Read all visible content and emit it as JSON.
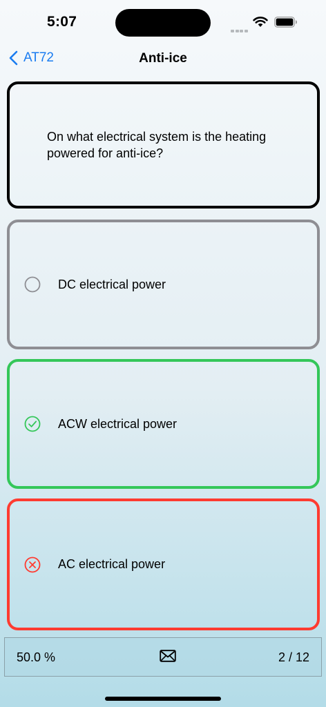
{
  "status_bar": {
    "time": "5:07",
    "icons": [
      "signal-dots-icon",
      "wifi-icon",
      "battery-icon"
    ]
  },
  "nav": {
    "back_label": "AT72",
    "title": "Anti-ice",
    "accent_color": "#1a7cf0"
  },
  "question": {
    "text": "On what electrical system is the heating powered for anti-ice?"
  },
  "answers": [
    {
      "label": "DC electrical power",
      "state": "unselected",
      "icon": "empty-circle-icon",
      "color": "#8e8e93"
    },
    {
      "label": "ACW electrical power",
      "state": "correct",
      "icon": "check-circle-icon",
      "color": "#34c759"
    },
    {
      "label": "AC electrical power",
      "state": "incorrect",
      "icon": "x-circle-icon",
      "color": "#ff3b30"
    }
  ],
  "footer": {
    "score": "50.0 %",
    "mail_icon": "envelope-icon",
    "progress": "2 / 12"
  }
}
